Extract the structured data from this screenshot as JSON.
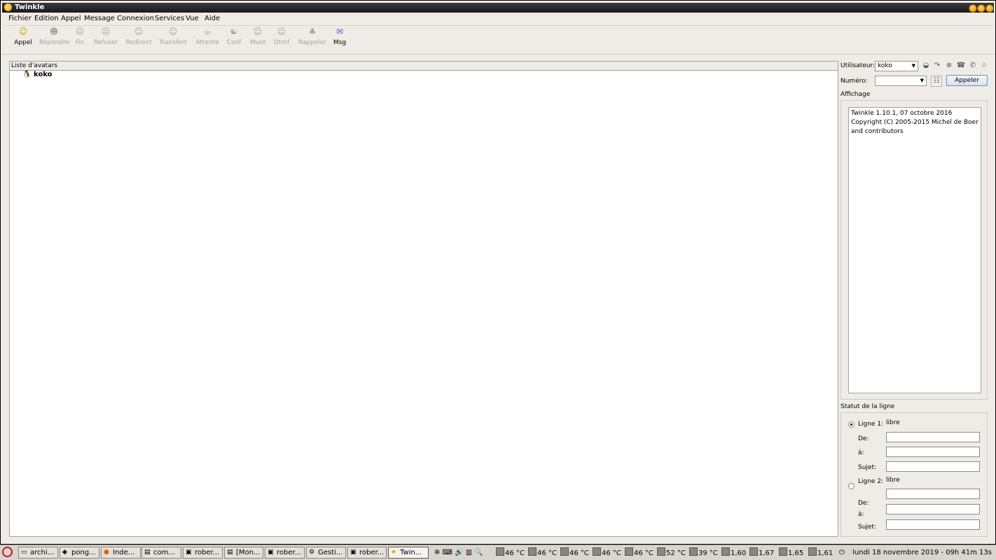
{
  "window": {
    "title": "Twinkle"
  },
  "menu": [
    "Fichier",
    "Edition",
    "Appel",
    "Message",
    "Connexion",
    "Services",
    "Vue",
    "Aide"
  ],
  "toolbar": [
    {
      "label": "Appel",
      "enabled": true,
      "icon": "smiley-icon"
    },
    {
      "label": "Répondre",
      "enabled": false,
      "icon": "answer-icon"
    },
    {
      "label": "Fin",
      "enabled": false,
      "icon": "hangup-icon"
    },
    {
      "label": "Refuser",
      "enabled": false,
      "icon": "reject-icon"
    },
    {
      "label": "Redirect",
      "enabled": false,
      "icon": "redirect-icon"
    },
    {
      "label": "Transfert",
      "enabled": false,
      "icon": "transfer-icon"
    },
    {
      "label": "Attente",
      "enabled": false,
      "icon": "hold-icon"
    },
    {
      "label": "Conf",
      "enabled": false,
      "icon": "conference-icon"
    },
    {
      "label": "Muet",
      "enabled": false,
      "icon": "mute-icon"
    },
    {
      "label": "Dtmf",
      "enabled": false,
      "icon": "dtmf-icon"
    },
    {
      "label": "Rappeler",
      "enabled": false,
      "icon": "redial-icon"
    },
    {
      "label": "Msg",
      "enabled": true,
      "icon": "message-icon"
    }
  ],
  "avatars": {
    "header": "Liste d'avatars",
    "items": [
      "koko"
    ]
  },
  "side": {
    "user_label": "Utilisateur:",
    "user_value": "koko",
    "number_label": "Numéro:",
    "number_value": "",
    "call_button": "Appeler",
    "display_title": "Affichage",
    "display_lines": [
      "Twinkle 1.10.1, 07 octobre 2016",
      "Copyright (C) 2005-2015  Michel de Boer",
      "and contributors"
    ],
    "status_title": "Statut de la ligne",
    "line1_label": "Ligne 1:",
    "line1_status": "libre",
    "line2_label": "Ligne 2:",
    "line2_status": "libre",
    "de_label": "De:",
    "a_label": "à:",
    "sujet_label": "Sujet:"
  },
  "taskbar": {
    "tasks": [
      "archi...",
      "pong...",
      "Inde...",
      "com...",
      "rober...",
      "[Mon...",
      "rober...",
      "Gesti...",
      "rober...",
      "Twin..."
    ],
    "active_task": "Twin...",
    "temps": [
      "46 °C",
      "46 °C",
      "46 °C",
      "46 °C",
      "46 °C",
      "52 °C",
      "39 °C"
    ],
    "freqs": [
      "1,60",
      "1,67",
      "1,65",
      "1,61"
    ],
    "clock": "lundi 18 novembre 2019 - 09h 41m 13s"
  }
}
